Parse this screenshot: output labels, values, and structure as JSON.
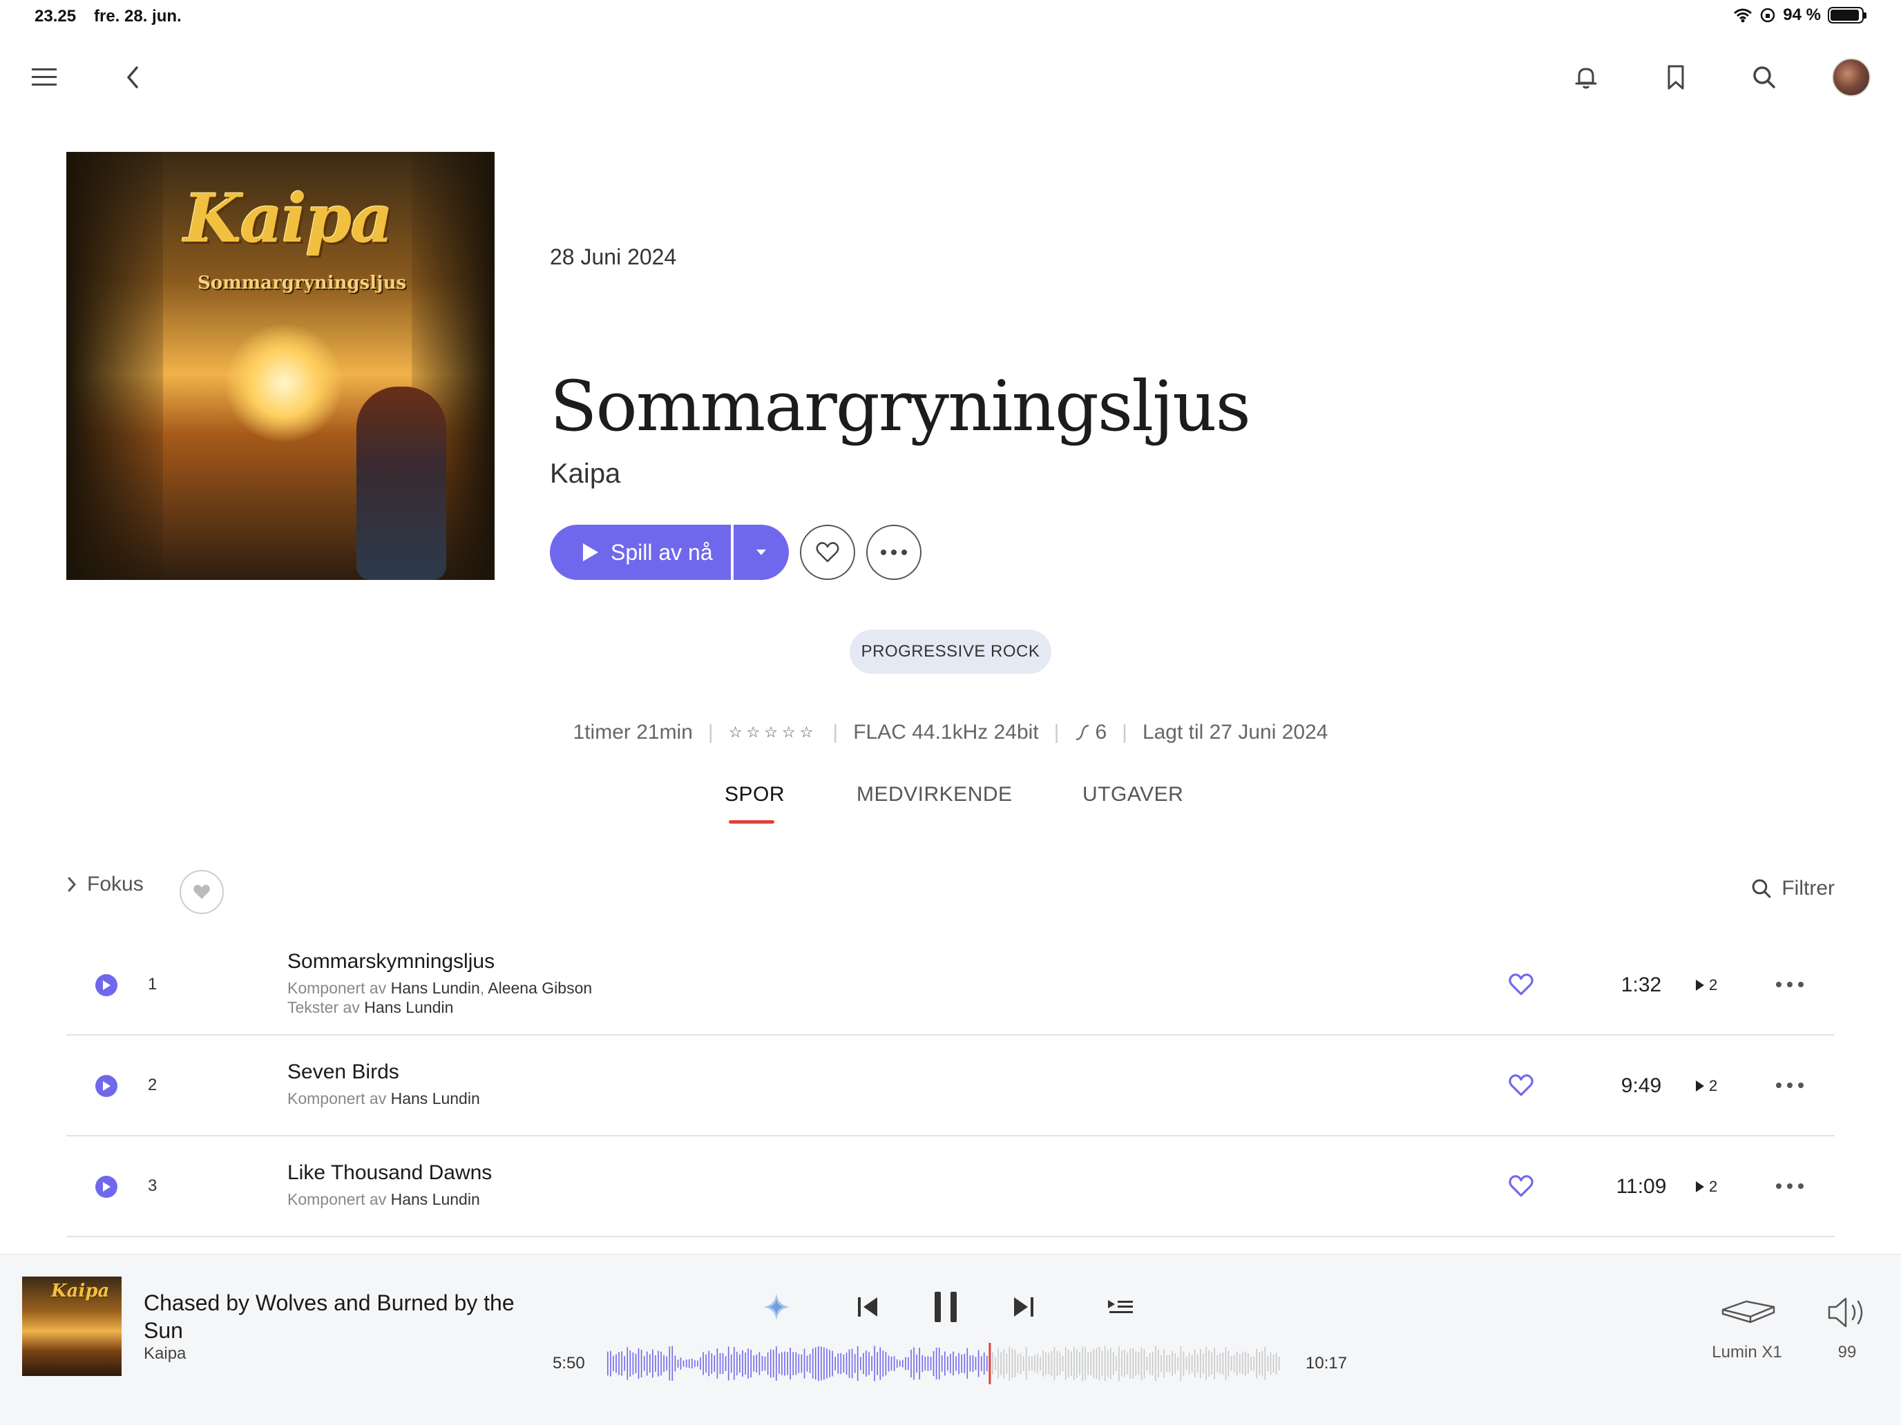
{
  "status_bar": {
    "time": "23.25",
    "date": "fre. 28. jun.",
    "battery": "94 %",
    "battery_level": 0.94
  },
  "album": {
    "cover_logo": "Kaipa",
    "cover_subtitle": "Sommargryningsljus",
    "release_date": "28 Juni 2024",
    "title": "Sommargryningsljus",
    "artist": "Kaipa",
    "play_label": "Spill av nå",
    "genre": "PROGRESSIVE ROCK"
  },
  "meta": {
    "duration": "1timer 21min",
    "rating": 0,
    "format": "FLAC 44.1kHz 24bit",
    "plays": "6",
    "added": "Lagt til 27 Juni 2024"
  },
  "tabs": [
    "SPOR",
    "MEDVIRKENDE",
    "UTGAVER"
  ],
  "toolbar": {
    "focus_label": "Fokus",
    "filter_label": "Filtrer"
  },
  "tracks": [
    {
      "number": "1",
      "title": "Sommarskymningsljus",
      "composed_label": "Komponert av",
      "composers": "Hans Lundin",
      "composers_extra": "Aleena Gibson",
      "lyrics_label": "Tekster av",
      "lyricists": "Hans Lundin",
      "duration": "1:32",
      "plays": "2"
    },
    {
      "number": "2",
      "title": "Seven Birds",
      "composed_label": "Komponert av",
      "composers": "Hans Lundin",
      "duration": "9:49",
      "plays": "2"
    },
    {
      "number": "3",
      "title": "Like Thousand Dawns",
      "composed_label": "Komponert av",
      "composers": "Hans Lundin",
      "duration": "11:09",
      "plays": "2"
    }
  ],
  "player": {
    "cover_logo": "Kaipa",
    "title": "Chased by Wolves and Burned by the Sun",
    "artist": "Kaipa",
    "elapsed": "5:50",
    "total": "10:17",
    "progress": 0.567,
    "device": "Lumin X1",
    "volume": "99"
  },
  "colors": {
    "accent": "#7068ec",
    "tab_underline": "#e0413a",
    "genre_bg": "#e4e9f3"
  }
}
